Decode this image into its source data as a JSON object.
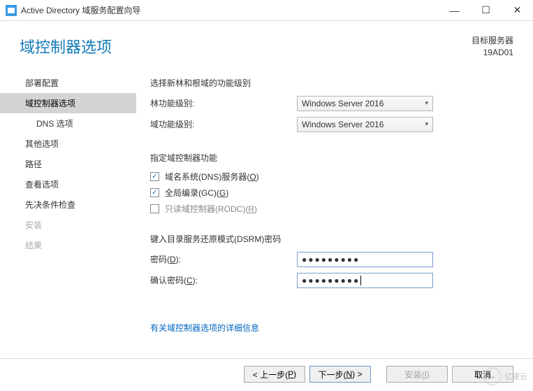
{
  "window": {
    "title": "Active Directory 域服务配置向导",
    "minimize": "—",
    "maximize": "☐",
    "close": "✕"
  },
  "header": {
    "page_title": "域控制器选项",
    "target_label": "目标服务器",
    "target_value": "19AD01"
  },
  "sidebar": {
    "items": [
      {
        "label": "部署配置"
      },
      {
        "label": "域控制器选项"
      },
      {
        "label": "DNS 选项"
      },
      {
        "label": "其他选项"
      },
      {
        "label": "路径"
      },
      {
        "label": "查看选项"
      },
      {
        "label": "先决条件检查"
      },
      {
        "label": "安装"
      },
      {
        "label": "结果"
      }
    ]
  },
  "content": {
    "section1_label": "选择新林和根域的功能级别",
    "forest_label": "林功能级别:",
    "forest_value": "Windows Server 2016",
    "domain_label": "域功能级别:",
    "domain_value": "Windows Server 2016",
    "section2_label": "指定域控制器功能",
    "chk_dns_pre": "域名系统(DNS)服务器(",
    "chk_dns_under": "O",
    "chk_dns_post": ")",
    "chk_gc_pre": "全局编录(GC)(",
    "chk_gc_under": "G",
    "chk_gc_post": ")",
    "chk_rodc_pre": "只读域控制器(RODC)(",
    "chk_rodc_under": "R",
    "chk_rodc_post": ")",
    "section3_label": "键入目录服务还原模式(DSRM)密码",
    "pw_label_pre": "密码(",
    "pw_label_under": "D",
    "pw_label_post": "):",
    "pw_value": "●●●●●●●●●",
    "cpw_label_pre": "确认密码(",
    "cpw_label_under": "C",
    "cpw_label_post": "):",
    "cpw_value": "●●●●●●●●●",
    "more_link": "有关域控制器选项的详细信息"
  },
  "footer": {
    "prev_pre": "< 上一步(",
    "prev_under": "P",
    "prev_post": ")",
    "next_pre": "下一步(",
    "next_under": "N",
    "next_post": ") >",
    "install_pre": "安装(",
    "install_under": "I",
    "install_post": ")",
    "cancel": "取消"
  },
  "watermark": {
    "text": "亿速云"
  }
}
